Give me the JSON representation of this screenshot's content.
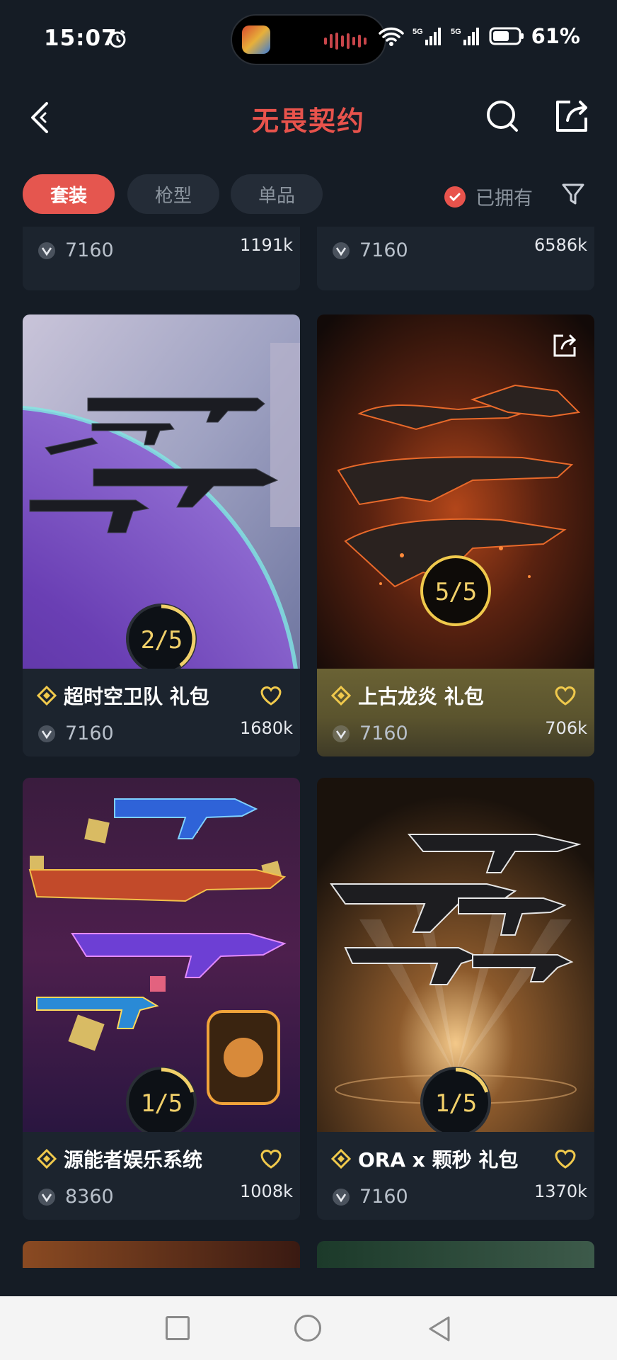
{
  "status_bar": {
    "time": "15:07",
    "battery": "61%",
    "network": "5G"
  },
  "header": {
    "title": "无畏契约"
  },
  "tabs": [
    {
      "label": "套装",
      "active": true
    },
    {
      "label": "枪型",
      "active": false
    },
    {
      "label": "单品",
      "active": false
    }
  ],
  "owned_filter": {
    "label": "已拥有",
    "checked": true
  },
  "cards": [
    {
      "name": "",
      "price": "7160",
      "count": "1191k"
    },
    {
      "name": "",
      "price": "7160",
      "count": "6586k"
    },
    {
      "name": "超时空卫队 礼包",
      "price": "7160",
      "count": "1680k",
      "progress": "2/5",
      "progress_value": 0.4
    },
    {
      "name": "上古龙炎 礼包",
      "price": "7160",
      "count": "706k",
      "progress": "5/5",
      "progress_value": 1.0,
      "owned": true
    },
    {
      "name": "源能者娱乐系统",
      "price": "8360",
      "count": "1008k",
      "progress": "1/5",
      "progress_value": 0.2
    },
    {
      "name": "ORA x 颗秒 礼包",
      "price": "7160",
      "count": "1370k",
      "progress": "1/5",
      "progress_value": 0.2
    }
  ],
  "colors": {
    "accent": "#e5564f",
    "background": "#151c25",
    "gold": "#f0c94c"
  }
}
